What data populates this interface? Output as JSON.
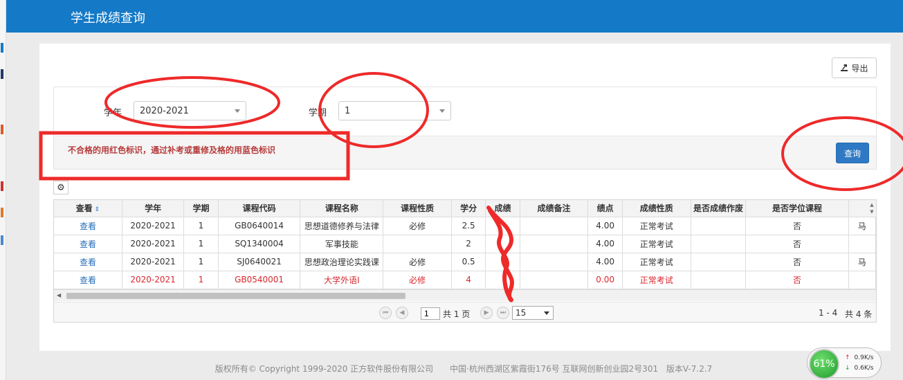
{
  "header": {
    "title": "学生成绩查询"
  },
  "toolbar": {
    "export_label": "导出",
    "export_icon": "export-icon"
  },
  "filter": {
    "year_label": "学年",
    "year_value": "2020-2021",
    "term_label": "学期",
    "term_value": "1",
    "note": "不合格的用红色标识，通过补考或重修及格的用蓝色标识",
    "query_label": "查询"
  },
  "table": {
    "headers": [
      "查看",
      "学年",
      "学期",
      "课程代码",
      "课程名称",
      "课程性质",
      "学分",
      "成绩",
      "成绩备注",
      "绩点",
      "成绩性质",
      "是否成绩作废",
      "是否学位课程",
      ""
    ],
    "rows": [
      {
        "view": "查看",
        "year": "2020-2021",
        "term": "1",
        "code": "GB0640014",
        "name": "思想道德修养与法律",
        "nature": "必修",
        "credit": "2.5",
        "score": "",
        "remark": "",
        "gpa": "4.00",
        "exam": "正常考试",
        "void": "",
        "degree": "否",
        "extra": "马",
        "fail": false
      },
      {
        "view": "查看",
        "year": "2020-2021",
        "term": "1",
        "code": "SQ1340004",
        "name": "军事技能",
        "nature": "",
        "credit": "2",
        "score": "",
        "remark": "",
        "gpa": "4.00",
        "exam": "正常考试",
        "void": "",
        "degree": "否",
        "extra": "",
        "fail": false
      },
      {
        "view": "查看",
        "year": "2020-2021",
        "term": "1",
        "code": "SJ0640021",
        "name": "思想政治理论实践课",
        "nature": "必修",
        "credit": "0.5",
        "score": "",
        "remark": "",
        "gpa": "4.00",
        "exam": "正常考试",
        "void": "",
        "degree": "否",
        "extra": "马",
        "fail": false
      },
      {
        "view": "查看",
        "year": "2020-2021",
        "term": "1",
        "code": "GB0540001",
        "name": "大学外语I",
        "nature": "必修",
        "credit": "4",
        "score": "",
        "remark": "",
        "gpa": "0.00",
        "exam": "正常考试",
        "void": "",
        "degree": "否",
        "extra": "",
        "fail": true
      }
    ]
  },
  "pager": {
    "page_value": "1",
    "total_pages": "共 1 页",
    "page_size": "15",
    "range": "1 - 4",
    "total": "共 4 条"
  },
  "footer": {
    "copyright": "版权所有© Copyright 1999-2020 正方软件股份有限公司",
    "address": "中国·杭州西湖区紫霞街176号 互联网创新创业园2号301",
    "version": "版本V-7.2.7"
  },
  "netmon": {
    "percent": "61%",
    "up": "0.9K/s",
    "down": "0.6K/s"
  },
  "colors": {
    "header_bg": "#1479c6",
    "fail_text": "#d9262d",
    "link": "#2a6fba",
    "annotation": "#ee2a2a"
  }
}
